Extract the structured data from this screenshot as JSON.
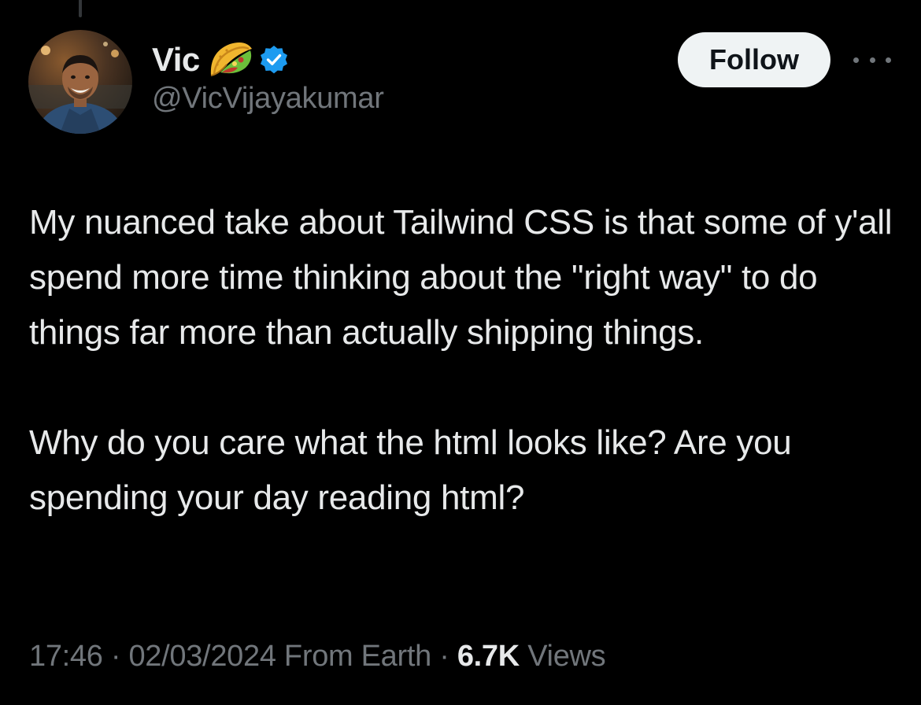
{
  "author": {
    "display_name": "Vic",
    "handle": "@VicVijayakumar",
    "name_emoji_icon": "taco-icon",
    "verified_icon": "verified-badge-icon"
  },
  "actions": {
    "follow_label": "Follow",
    "more_icon": "more-options-icon"
  },
  "tweet": {
    "paragraphs": [
      "My nuanced take about Tailwind CSS is that some of y'all spend more time thinking about the \"right way\" to do things far more than actually shipping things.",
      "Why do you care what the html looks like? Are you spending your day reading html?"
    ],
    "time": "17:46",
    "date": "02/03/2024",
    "source": "From Earth",
    "separator": " · ",
    "views_count": "6.7K",
    "views_label": "Views"
  },
  "colors": {
    "background": "#000000",
    "primary_text": "#e7e9ea",
    "secondary_text": "#71767b",
    "follow_bg": "#eff3f4",
    "verified_blue": "#1d9bf0"
  }
}
